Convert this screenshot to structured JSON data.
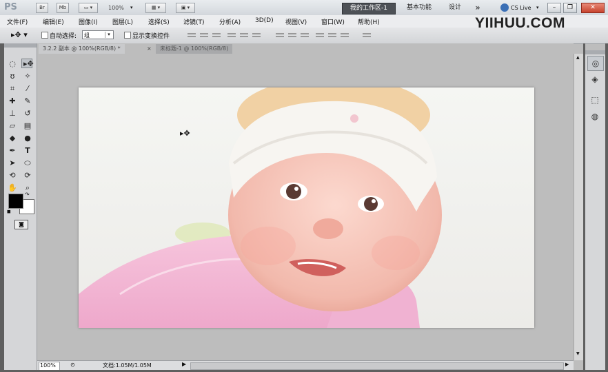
{
  "app": {
    "logo": "PS",
    "buttons": [
      "Br",
      "Mb"
    ],
    "zoom": "100%",
    "workspaces": [
      "我的工作区-1",
      "基本功能",
      "设计"
    ],
    "overflow": "»",
    "cs_live": "CS Live",
    "watermark": "YIIHUU.COM"
  },
  "menu": [
    "文件(F)",
    "编辑(E)",
    "图像(I)",
    "图层(L)",
    "选择(S)",
    "滤镜(T)",
    "分析(A)",
    "3D(D)",
    "视图(V)",
    "窗口(W)",
    "帮助(H)"
  ],
  "options": {
    "auto_select_label": "自动选择:",
    "auto_select_value": "组",
    "show_transform_label": "显示变换控件"
  },
  "tabs": [
    "3.2.2 副本 @ 100%(RGB/8) *",
    "未标题-1 @ 100%(RGB/8)"
  ],
  "status": {
    "zoom": "100%",
    "doc": "文档:1.05M/1.05M"
  },
  "colors": {
    "foreground": "#000000",
    "background": "#ffffff",
    "active_workspace": "#4d5156"
  },
  "tools": [
    "marquee-icon",
    "move-icon",
    "lasso-icon",
    "magic-wand-icon",
    "crop-icon",
    "eyedropper-icon",
    "healing-brush-icon",
    "brush-icon",
    "clone-stamp-icon",
    "history-brush-icon",
    "eraser-icon",
    "gradient-icon",
    "blur-icon",
    "dodge-icon",
    "pen-icon",
    "type-icon",
    "path-select-icon",
    "shape-icon",
    "3d-rotate-icon",
    "3d-orbit-icon",
    "hand-icon",
    "zoom-icon"
  ]
}
